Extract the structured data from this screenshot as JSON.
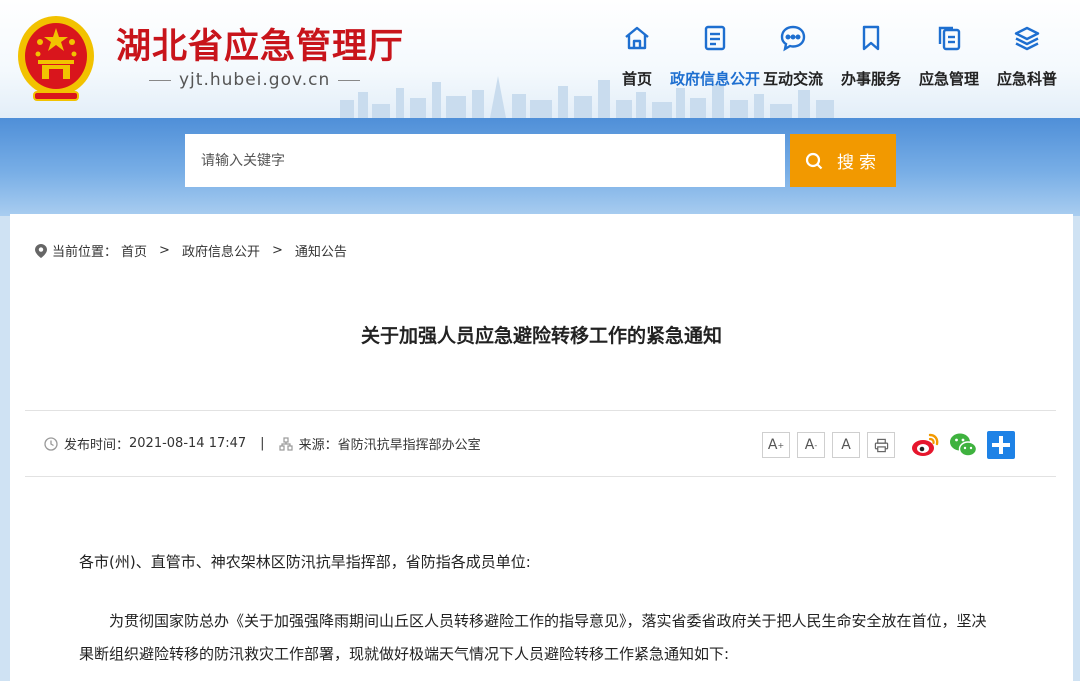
{
  "header": {
    "site_title": "湖北省应急管理厅",
    "site_domain": "yjt.hubei.gov.cn",
    "emblem_icon": "national-emblem-icon",
    "nav": [
      {
        "label": "首页",
        "icon": "home-icon"
      },
      {
        "label": "政府信息公开",
        "icon": "document-list-icon",
        "active": true
      },
      {
        "label": "互动交流",
        "icon": "chat-bubble-icon"
      },
      {
        "label": "办事服务",
        "icon": "bookmark-icon"
      },
      {
        "label": "应急管理",
        "icon": "copy-document-icon"
      },
      {
        "label": "应急科普",
        "icon": "layers-icon"
      }
    ]
  },
  "search": {
    "placeholder": "请输入关键字",
    "button_label": "搜索",
    "icon": "search-icon"
  },
  "breadcrumb": {
    "label": "当前位置：",
    "items": [
      "首页",
      "政府信息公开",
      "通知公告"
    ],
    "separator": ">"
  },
  "article": {
    "title": "关于加强人员应急避险转移工作的紧急通知",
    "publish_label": "发布时间：",
    "publish_time": "2021-08-14 17:47",
    "meta_separator": "|",
    "source_label": "来源：",
    "source": "省防汛抗旱指挥部办公室",
    "salutation": "各市(州)、直管市、神农架林区防汛抗旱指挥部，省防指各成员单位:",
    "paragraph_1": "为贯彻国家防总办《关于加强强降雨期间山丘区人员转移避险工作的指导意见》，落实省委省政府关于把人民生命安全放在首位，坚决果断组织避险转移的防汛救灾工作部署，现就做好极端天气情况下人员避险转移工作紧急通知如下:"
  },
  "tools": {
    "font_large": "A",
    "font_medium": "A",
    "font_small": "A",
    "print_icon": "print-icon",
    "share": [
      "weibo-icon",
      "wechat-icon",
      "share-plus-icon"
    ]
  },
  "colors": {
    "brand_red": "#c8141b",
    "nav_active": "#1e6fd0",
    "search_button": "#f29900",
    "band_blue": "#4f8fd8"
  }
}
